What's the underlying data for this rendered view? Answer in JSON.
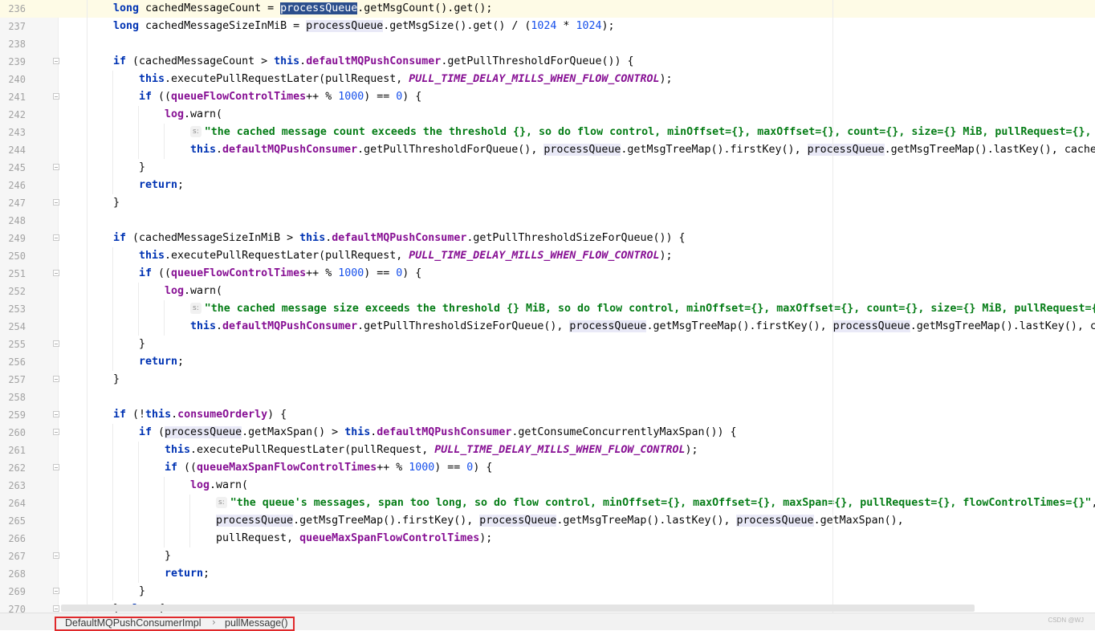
{
  "editor": {
    "current_line": 236,
    "lines": [
      {
        "n": "236",
        "indent": 0,
        "fold": false,
        "html": "<span class=\"kw\">long</span> cachedMessageCount = <span class=\"pqsel\">processQueue</span>.getMsgCount().get();"
      },
      {
        "n": "237",
        "indent": 0,
        "fold": false,
        "html": "<span class=\"kw\">long</span> cachedMessageSizeInMiB = <span class=\"pq\">processQueue</span>.getMsgSize().get() / (<span class=\"num\">1024</span> * <span class=\"num\">1024</span>);"
      },
      {
        "n": "238",
        "indent": 0,
        "fold": false,
        "html": ""
      },
      {
        "n": "239",
        "indent": 0,
        "fold": true,
        "html": "<span class=\"kw\">if</span> (cachedMessageCount &gt; <span class=\"kw\">this</span>.<span class=\"fld\">defaultMQPushConsumer</span>.getPullThresholdForQueue()) {"
      },
      {
        "n": "240",
        "indent": 1,
        "fold": false,
        "html": "<span class=\"kw\">this</span>.executePullRequestLater(pullRequest, <span class=\"sfld\">PULL_TIME_DELAY_MILLS_WHEN_FLOW_CONTROL</span>);"
      },
      {
        "n": "241",
        "indent": 1,
        "fold": true,
        "html": "<span class=\"kw\">if</span> ((<span class=\"fld\">queueFlowControlTimes</span>++ % <span class=\"num\">1000</span>) == <span class=\"num\">0</span>) {"
      },
      {
        "n": "242",
        "indent": 2,
        "fold": false,
        "html": "<span class=\"fld\">log</span>.warn("
      },
      {
        "n": "243",
        "indent": 3,
        "fold": false,
        "html": "<span class=\"hint\">s:</span><span class=\"str\">\"the cached message count exceeds the threshold {}, so do flow control, minOffset={}, maxOffset={}, count={}, size={} MiB, pullRequest={}, flowControlTimes={}\"</span>,"
      },
      {
        "n": "244",
        "indent": 3,
        "fold": false,
        "html": "<span class=\"kw\">this</span>.<span class=\"fld\">defaultMQPushConsumer</span>.getPullThresholdForQueue(), <span class=\"pq\">processQueue</span>.getMsgTreeMap().firstKey(), <span class=\"pq\">processQueue</span>.getMsgTreeMap().lastKey(), cachedMessageCount, cachedMessageSizeInMiB, pullRequest, queueFlowControlTimes);"
      },
      {
        "n": "245",
        "indent": 1,
        "fold": true,
        "html": "}"
      },
      {
        "n": "246",
        "indent": 1,
        "fold": false,
        "html": "<span class=\"kw\">return</span>;"
      },
      {
        "n": "247",
        "indent": 0,
        "fold": true,
        "html": "}"
      },
      {
        "n": "248",
        "indent": 0,
        "fold": false,
        "html": ""
      },
      {
        "n": "249",
        "indent": 0,
        "fold": true,
        "html": "<span class=\"kw\">if</span> (cachedMessageSizeInMiB &gt; <span class=\"kw\">this</span>.<span class=\"fld\">defaultMQPushConsumer</span>.getPullThresholdSizeForQueue()) {"
      },
      {
        "n": "250",
        "indent": 1,
        "fold": false,
        "html": "<span class=\"kw\">this</span>.executePullRequestLater(pullRequest, <span class=\"sfld\">PULL_TIME_DELAY_MILLS_WHEN_FLOW_CONTROL</span>);"
      },
      {
        "n": "251",
        "indent": 1,
        "fold": true,
        "html": "<span class=\"kw\">if</span> ((<span class=\"fld\">queueFlowControlTimes</span>++ % <span class=\"num\">1000</span>) == <span class=\"num\">0</span>) {"
      },
      {
        "n": "252",
        "indent": 2,
        "fold": false,
        "html": "<span class=\"fld\">log</span>.warn("
      },
      {
        "n": "253",
        "indent": 3,
        "fold": false,
        "html": "<span class=\"hint\">s:</span><span class=\"str\">\"the cached message size exceeds the threshold {} MiB, so do flow control, minOffset={}, maxOffset={}, count={}, size={} MiB, pullRequest={}, flowControlTimes={}\"</span>,"
      },
      {
        "n": "254",
        "indent": 3,
        "fold": false,
        "html": "<span class=\"kw\">this</span>.<span class=\"fld\">defaultMQPushConsumer</span>.getPullThresholdSizeForQueue(), <span class=\"pq\">processQueue</span>.getMsgTreeMap().firstKey(), <span class=\"pq\">processQueue</span>.getMsgTreeMap().lastKey(), cachedMessageCount, cachedMessageSizeInMiB, pullRequest, queueFlowControlTimes);"
      },
      {
        "n": "255",
        "indent": 1,
        "fold": true,
        "html": "}"
      },
      {
        "n": "256",
        "indent": 1,
        "fold": false,
        "html": "<span class=\"kw\">return</span>;"
      },
      {
        "n": "257",
        "indent": 0,
        "fold": true,
        "html": "}"
      },
      {
        "n": "258",
        "indent": 0,
        "fold": false,
        "html": ""
      },
      {
        "n": "259",
        "indent": 0,
        "fold": true,
        "html": "<span class=\"kw\">if</span> (!<span class=\"kw\">this</span>.<span class=\"fld\">consumeOrderly</span>) {"
      },
      {
        "n": "260",
        "indent": 1,
        "fold": true,
        "html": "<span class=\"kw\">if</span> (<span class=\"pq\">processQueue</span>.getMaxSpan() &gt; <span class=\"kw\">this</span>.<span class=\"fld\">defaultMQPushConsumer</span>.getConsumeConcurrentlyMaxSpan()) {"
      },
      {
        "n": "261",
        "indent": 2,
        "fold": false,
        "html": "<span class=\"kw\">this</span>.executePullRequestLater(pullRequest, <span class=\"sfld\">PULL_TIME_DELAY_MILLS_WHEN_FLOW_CONTROL</span>);"
      },
      {
        "n": "262",
        "indent": 2,
        "fold": true,
        "html": "<span class=\"kw\">if</span> ((<span class=\"fld\">queueMaxSpanFlowControlTimes</span>++ % <span class=\"num\">1000</span>) == <span class=\"num\">0</span>) {"
      },
      {
        "n": "263",
        "indent": 3,
        "fold": false,
        "html": "<span class=\"fld\">log</span>.warn("
      },
      {
        "n": "264",
        "indent": 4,
        "fold": false,
        "html": "<span class=\"hint\">s:</span><span class=\"str\">\"the queue's messages, span too long, so do flow control, minOffset={}, maxOffset={}, maxSpan={}, pullRequest={}, flowControlTimes={}\"</span>,"
      },
      {
        "n": "265",
        "indent": 4,
        "fold": false,
        "html": "<span class=\"pq\">processQueue</span>.getMsgTreeMap().firstKey(), <span class=\"pq\">processQueue</span>.getMsgTreeMap().lastKey(), <span class=\"pq\">processQueue</span>.getMaxSpan(),"
      },
      {
        "n": "266",
        "indent": 4,
        "fold": false,
        "html": "pullRequest, <span class=\"fld\">queueMaxSpanFlowControlTimes</span>);"
      },
      {
        "n": "267",
        "indent": 2,
        "fold": true,
        "html": "}"
      },
      {
        "n": "268",
        "indent": 2,
        "fold": false,
        "html": "<span class=\"kw\">return</span>;"
      },
      {
        "n": "269",
        "indent": 1,
        "fold": true,
        "html": "}"
      },
      {
        "n": "270",
        "indent": 0,
        "fold": true,
        "html": "} <span class=\"kw\">else</span> {"
      }
    ]
  },
  "breadcrumbs": {
    "class_name": "DefaultMQPushConsumerImpl",
    "separator": "›",
    "method_name": "pullMessage()"
  },
  "watermark": "CSDN @WJ"
}
